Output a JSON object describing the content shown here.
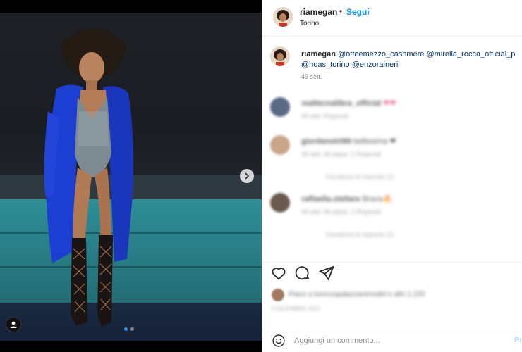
{
  "post": {
    "username": "riamegan",
    "bullet": "•",
    "follow_label": "Segui",
    "location": "Torino"
  },
  "caption": {
    "username": "riamegan",
    "mentions_line1": "@ottoemezzo_cashmere @mirella_rocca_official_p",
    "mentions_line2": "@hoas_torino @enzoraineri",
    "time": "49 sett."
  },
  "comments": [
    {
      "author": "realtecnalibra_official",
      "text": "❤❤",
      "meta": "49 sett.   Rispondi",
      "replies": ""
    },
    {
      "author": "giordanotrt99",
      "text": "bellissima ❤",
      "meta": "49 sett.   Mi piace: 1   Rispondi",
      "replies": "Visualizza le risposte (1)"
    },
    {
      "author": "raffaella.stellare",
      "text": "Brava🔥",
      "meta": "49 sett.   Mi piace: 1   Rispondi",
      "replies": "Visualizza le risposte (1)"
    }
  ],
  "likes": {
    "text": "Piace a lorenzopalazzanimodel e altri 1.220"
  },
  "post_date": "4 DICEMBRE 2021",
  "add_comment": {
    "placeholder": "Aggiungi un commento...",
    "publish_label": "Pu"
  },
  "carousel": {
    "current": 1,
    "total": 2
  },
  "colors": {
    "accent": "#0095f6",
    "stage_teal": "#2a7f88",
    "coat_blue": "#1d3fd1"
  },
  "icons": [
    "heart-icon",
    "comment-icon",
    "share-icon",
    "emoji-icon",
    "chevron-right-icon",
    "user-tag-icon"
  ]
}
